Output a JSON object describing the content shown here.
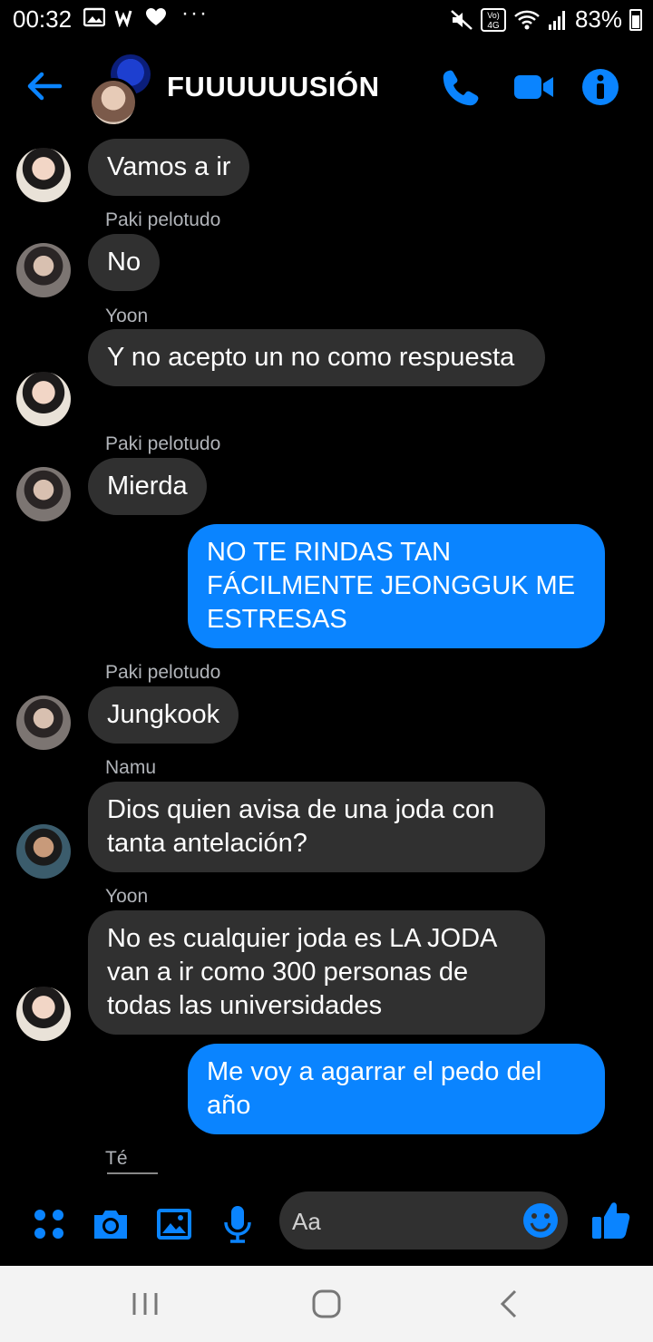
{
  "status_bar": {
    "time": "00:32",
    "network_label": "Vo) 4G",
    "battery": "83%",
    "more": "···"
  },
  "header": {
    "title": "FUUUUUUSIÓN"
  },
  "messages": [
    {
      "sender": "",
      "text": "Vamos a ir",
      "mine": false,
      "avatar": "yoon"
    },
    {
      "sender": "Paki pelotudo",
      "text": "No",
      "mine": false,
      "avatar": "paki"
    },
    {
      "sender": "Yoon",
      "text": "Y no acepto un no como respuesta",
      "mine": false,
      "avatar": "yoon"
    },
    {
      "sender": "Paki pelotudo",
      "text": "Mierda",
      "mine": false,
      "avatar": "paki"
    },
    {
      "sender": "",
      "text": "NO TE RINDAS TAN FÁCILMENTE JEONGGUK ME ESTRESAS",
      "mine": true
    },
    {
      "sender": "Paki pelotudo",
      "text": "Jungkook",
      "mine": false,
      "avatar": "paki"
    },
    {
      "sender": "Namu",
      "text": "Dios quien avisa de una joda con tanta antelación?",
      "mine": false,
      "avatar": "namu"
    },
    {
      "sender": "Yoon",
      "text": "No es cualquier joda es LA JODA van a ir como 300 personas de todas las universidades",
      "mine": false,
      "avatar": "yoon"
    },
    {
      "sender": "",
      "text": "Me voy a agarrar el pedo del año",
      "mine": true
    }
  ],
  "typing": {
    "sender": "Té"
  },
  "composer": {
    "placeholder": "Aa"
  },
  "colors": {
    "accent": "#0a84ff",
    "bubble_other": "#303030",
    "background": "#000000"
  }
}
